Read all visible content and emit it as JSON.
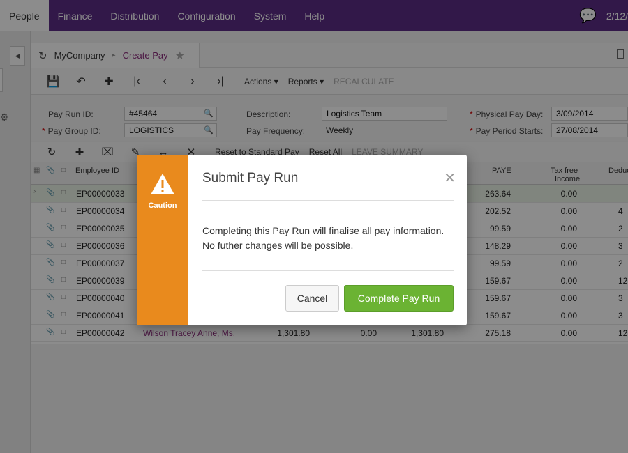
{
  "nav": {
    "tabs": [
      "People",
      "Finance",
      "Distribution",
      "Configuration",
      "System",
      "Help"
    ],
    "date": "2/12/"
  },
  "breadcrumb": {
    "company": "MyCompany",
    "page": "Create Pay"
  },
  "toolbar": {
    "actions": "Actions",
    "reports": "Reports",
    "recalculate": "RECALCULATE"
  },
  "form": {
    "pay_run_id_label": "Pay Run ID:",
    "pay_run_id": "#45464",
    "pay_group_id_label": "Pay Group ID:",
    "pay_group_id": "LOGISTICS",
    "description_label": "Description:",
    "description": "Logistics Team",
    "pay_frequency_label": "Pay Frequency:",
    "pay_frequency": "Weekly",
    "physical_pay_day_label": "Physical Pay Day:",
    "physical_pay_day": "3/09/2014",
    "pay_period_starts_label": "Pay Period Starts:",
    "pay_period_starts": "27/08/2014"
  },
  "grid_toolbar": {
    "reset_standard": "Reset to Standard Pay",
    "reset_all": "Reset All",
    "leave_summary": "LEAVE SUMMARY"
  },
  "grid": {
    "headers": {
      "employee_id": "Employee ID",
      "paye": "PAYE",
      "tax_free": "Tax free",
      "tax_free2": "Income",
      "deduc": "Deduc"
    },
    "rows": [
      {
        "id": "EP00000033",
        "paye": "263.64",
        "tax": "0.00",
        "ded": ""
      },
      {
        "id": "EP00000034",
        "paye": "202.52",
        "tax": "0.00",
        "ded": "4"
      },
      {
        "id": "EP00000035",
        "paye": "99.59",
        "tax": "0.00",
        "ded": "2"
      },
      {
        "id": "EP00000036",
        "paye": "148.29",
        "tax": "0.00",
        "ded": "3"
      },
      {
        "id": "EP00000037",
        "paye": "99.59",
        "tax": "0.00",
        "ded": "2"
      },
      {
        "id": "EP00000039",
        "paye": "159.67",
        "tax": "0.00",
        "ded": "12"
      },
      {
        "id": "EP00000040",
        "paye": "159.67",
        "tax": "0.00",
        "ded": "3"
      },
      {
        "id": "EP00000041",
        "paye": "159.67",
        "tax": "0.00",
        "ded": "3"
      },
      {
        "id": "EP00000042",
        "name": "Wilson Tracey Anne, Ms.",
        "gross": "1,301.80",
        "adj": "0.00",
        "net": "1,301.80",
        "paye": "275.18",
        "tax": "0.00",
        "ded": "12"
      }
    ]
  },
  "modal": {
    "side_label": "Caution",
    "title": "Submit Pay Run",
    "line1": "Completing this Pay Run will finalise all pay information.",
    "line2": "No futher changes will be possible.",
    "cancel": "Cancel",
    "complete": "Complete Pay Run"
  }
}
